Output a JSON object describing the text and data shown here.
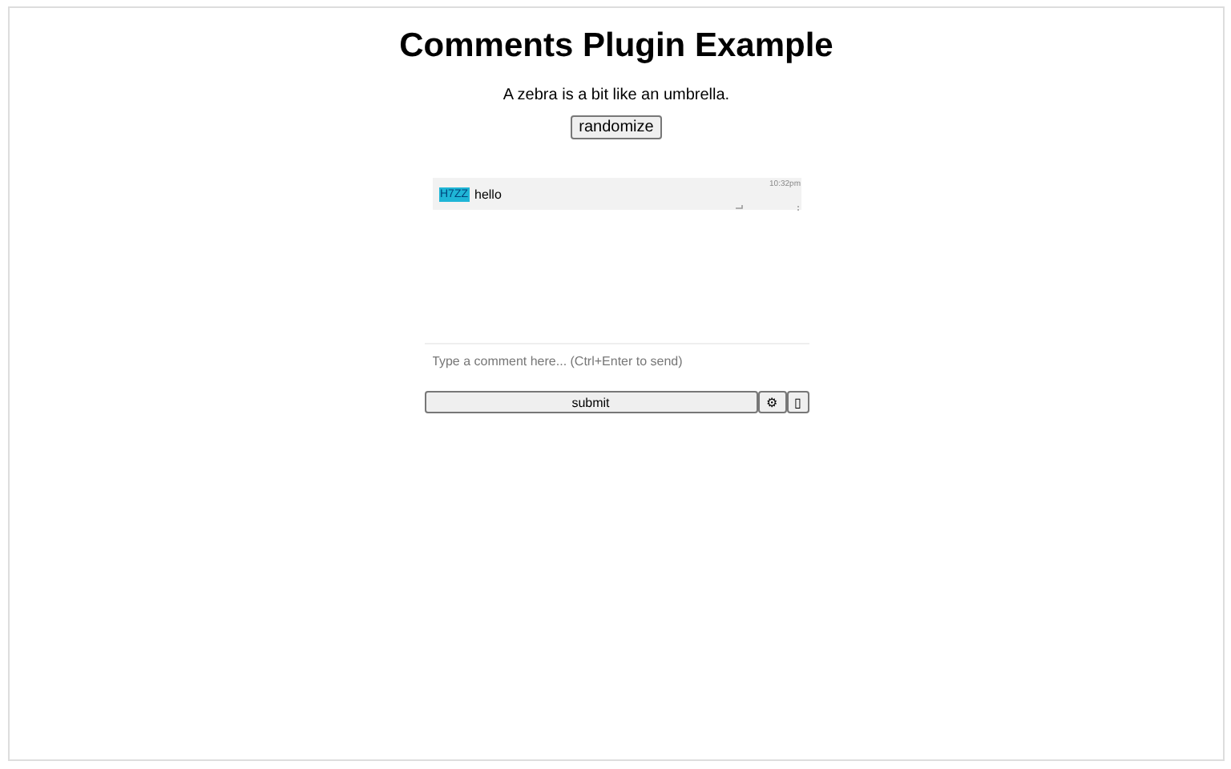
{
  "title": "Comments Plugin Example",
  "sentence": "A zebra is a bit like an umbrella.",
  "randomize_button": "randomize",
  "comments": [
    {
      "author": "H7ZZ",
      "color": "#1fb5d6",
      "text": "hello",
      "time": "10:32pm"
    }
  ],
  "composer": {
    "placeholder": "Type a comment here... (Ctrl+Enter to send)",
    "submit": "submit",
    "settings": "⚙",
    "extra": "▯"
  }
}
